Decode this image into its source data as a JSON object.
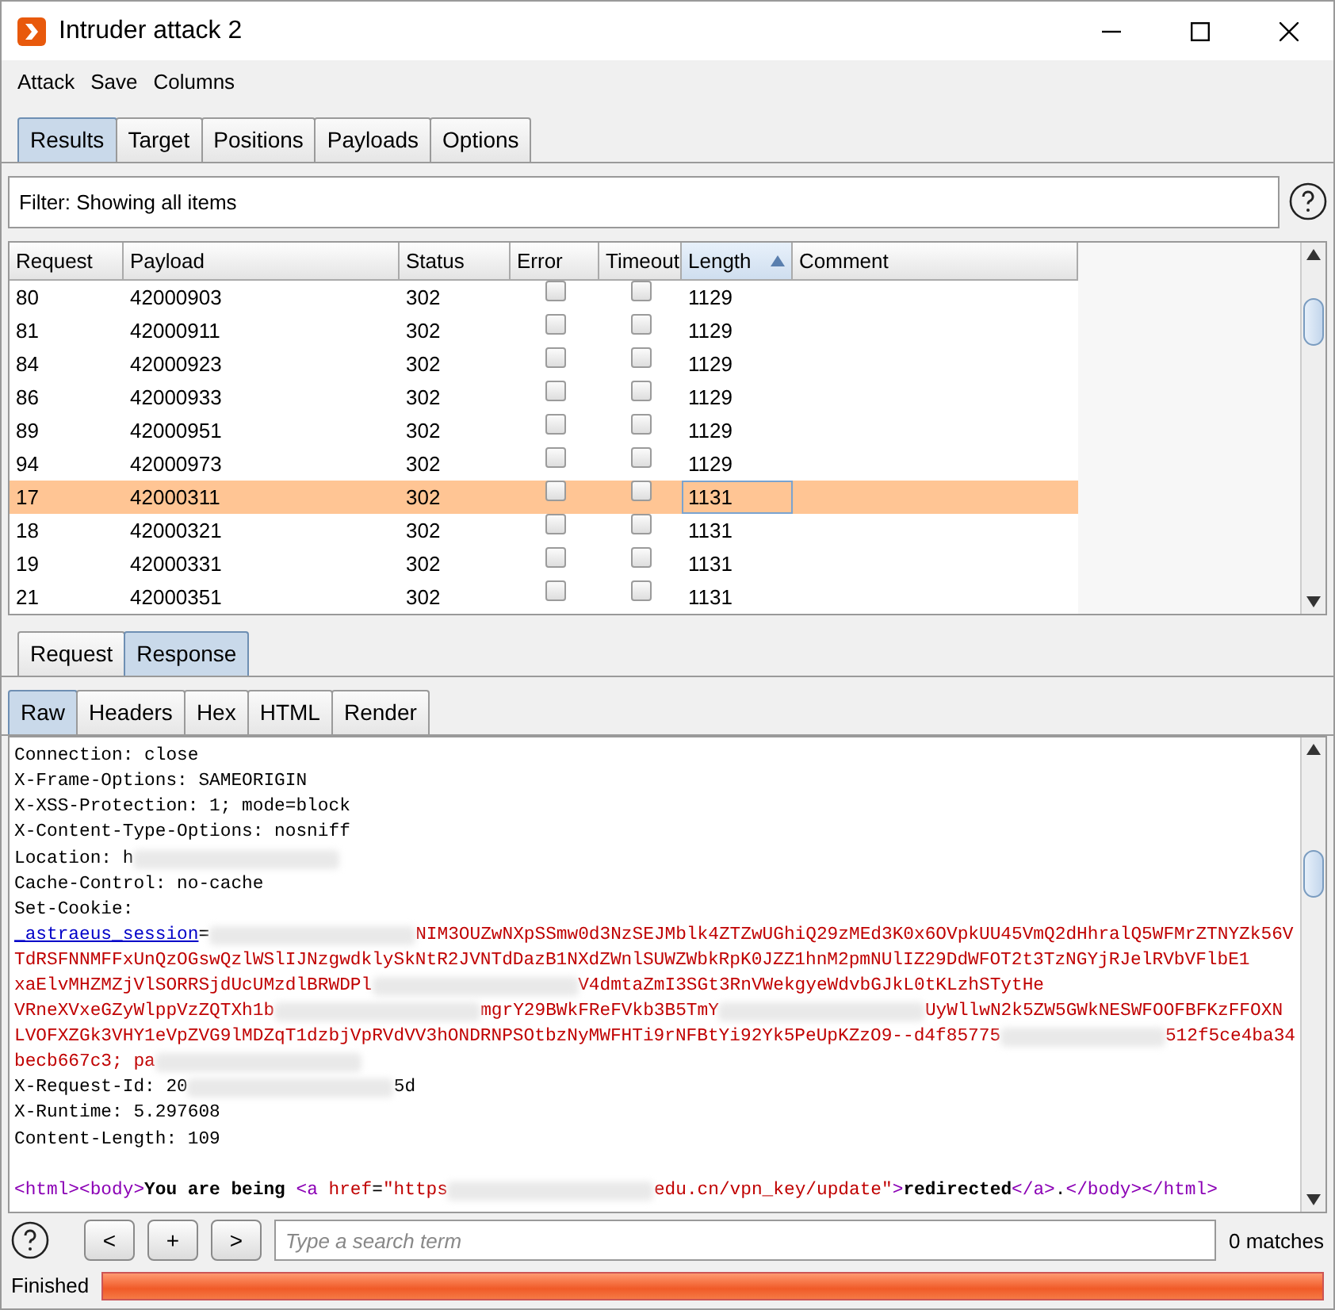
{
  "window": {
    "title": "Intruder attack 2"
  },
  "menu": [
    "Attack",
    "Save",
    "Columns"
  ],
  "tabs": [
    {
      "label": "Results",
      "selected": true
    },
    {
      "label": "Target",
      "selected": false
    },
    {
      "label": "Positions",
      "selected": false
    },
    {
      "label": "Payloads",
      "selected": false
    },
    {
      "label": "Options",
      "selected": false
    }
  ],
  "filter": {
    "text": "Filter: Showing all items"
  },
  "table": {
    "columns": [
      {
        "label": "Request",
        "sorted": false
      },
      {
        "label": "Payload",
        "sorted": false
      },
      {
        "label": "Status",
        "sorted": false
      },
      {
        "label": "Error",
        "sorted": false
      },
      {
        "label": "Timeout",
        "sorted": false
      },
      {
        "label": "Length",
        "sorted": true
      },
      {
        "label": "Comment",
        "sorted": false
      }
    ],
    "rows": [
      {
        "request": "80",
        "payload": "42000903",
        "status": "302",
        "error": false,
        "timeout": false,
        "length": "1129",
        "selected": false
      },
      {
        "request": "81",
        "payload": "42000911",
        "status": "302",
        "error": false,
        "timeout": false,
        "length": "1129",
        "selected": false
      },
      {
        "request": "84",
        "payload": "42000923",
        "status": "302",
        "error": false,
        "timeout": false,
        "length": "1129",
        "selected": false
      },
      {
        "request": "86",
        "payload": "42000933",
        "status": "302",
        "error": false,
        "timeout": false,
        "length": "1129",
        "selected": false
      },
      {
        "request": "89",
        "payload": "42000951",
        "status": "302",
        "error": false,
        "timeout": false,
        "length": "1129",
        "selected": false
      },
      {
        "request": "94",
        "payload": "42000973",
        "status": "302",
        "error": false,
        "timeout": false,
        "length": "1129",
        "selected": false
      },
      {
        "request": "17",
        "payload": "42000311",
        "status": "302",
        "error": false,
        "timeout": false,
        "length": "1131",
        "selected": true
      },
      {
        "request": "18",
        "payload": "42000321",
        "status": "302",
        "error": false,
        "timeout": false,
        "length": "1131",
        "selected": false
      },
      {
        "request": "19",
        "payload": "42000331",
        "status": "302",
        "error": false,
        "timeout": false,
        "length": "1131",
        "selected": false
      },
      {
        "request": "21",
        "payload": "42000351",
        "status": "302",
        "error": false,
        "timeout": false,
        "length": "1131",
        "selected": false
      }
    ]
  },
  "message_tabs": [
    {
      "label": "Request",
      "selected": false
    },
    {
      "label": "Response",
      "selected": true
    }
  ],
  "view_tabs": [
    {
      "label": "Raw",
      "selected": true
    },
    {
      "label": "Headers",
      "selected": false
    },
    {
      "label": "Hex",
      "selected": false
    },
    {
      "label": "HTML",
      "selected": false
    },
    {
      "label": "Render",
      "selected": false
    }
  ],
  "response_lines": [
    [
      {
        "kind": "plain",
        "text": "Connection: close"
      }
    ],
    [
      {
        "kind": "plain",
        "text": "X-Frame-Options: SAMEORIGIN"
      }
    ],
    [
      {
        "kind": "plain",
        "text": "X-XSS-Protection: 1; mode=block"
      }
    ],
    [
      {
        "kind": "plain",
        "text": "X-Content-Type-Options: nosniff"
      }
    ],
    [
      {
        "kind": "plain",
        "text": "Location: h"
      },
      {
        "kind": "redacted"
      }
    ],
    [
      {
        "kind": "plain",
        "text": "Cache-Control: no-cache"
      }
    ],
    [
      {
        "kind": "plain",
        "text": "Set-Cookie:"
      }
    ],
    [
      {
        "kind": "cookie-name",
        "text": "_astraeus_session"
      },
      {
        "kind": "plain",
        "text": "="
      },
      {
        "kind": "redacted"
      },
      {
        "kind": "value",
        "text": "NIM3OUZwNXpSSmw0d3NzSEJMblk4ZTZwUGhiQ29zMEd3K0x6OVpkUU45VmQ2dHhralQ5WFMrZTNYZk56V"
      }
    ],
    [
      {
        "kind": "value",
        "text": "TdRSFNNMFFxUnQzOGswQzlWSlIJNzgwdklySkNtR2JVNTdDazB1NXdZWnlSUWZWbkRpK0JZZ1hnM2pmNUlIZ29DdWFOT2t3TzNGYjRJelRVbVFlbE1"
      }
    ],
    [
      {
        "kind": "value",
        "text": "xaElvMHZMZjVlSORRSjdUcUMzdlBRWDPl"
      },
      {
        "kind": "redacted"
      },
      {
        "kind": "value",
        "text": "V4dmtaZmI3SGt3RnVWekgyeWdvbGJkL0tKLzhSTytHe"
      }
    ],
    [
      {
        "kind": "value",
        "text": "VRneXVxeGZyWlppVzZQTXh1b"
      },
      {
        "kind": "redacted"
      },
      {
        "kind": "value",
        "text": "mgrY29BWkFReFVkb3B5TmY"
      },
      {
        "kind": "redacted"
      },
      {
        "kind": "value",
        "text": "UyWllwN2k5ZW5GWkNESWFOOFBFKzFFOXN"
      }
    ],
    [
      {
        "kind": "value",
        "text": "LVOFXZGk3VHY1eVpZVG9lMDZqT1dzbjVpRVdVV3hONDRNPSOtbzNyMWFHTi9rNFBtYi92Yk5PeUpKZzO9--d4f85775"
      },
      {
        "kind": "redacted"
      },
      {
        "kind": "value",
        "text": "512f5ce4ba34"
      }
    ],
    [
      {
        "kind": "value",
        "text": "becb667c3; pa"
      },
      {
        "kind": "redacted"
      }
    ],
    [
      {
        "kind": "plain",
        "text": "X-Request-Id: 20"
      },
      {
        "kind": "redacted"
      },
      {
        "kind": "plain",
        "text": "5d"
      }
    ],
    [
      {
        "kind": "plain",
        "text": "X-Runtime: 5.297608"
      }
    ],
    [
      {
        "kind": "plain",
        "text": "Content-Length: 109"
      }
    ],
    [
      {
        "kind": "blank"
      }
    ],
    [
      {
        "kind": "tag",
        "text": "<html><body>"
      },
      {
        "kind": "body",
        "text": "You are being "
      },
      {
        "kind": "tag",
        "text": "<a "
      },
      {
        "kind": "attr",
        "text": "href"
      },
      {
        "kind": "plain",
        "text": "="
      },
      {
        "kind": "value",
        "text": "\"https"
      },
      {
        "kind": "redacted"
      },
      {
        "kind": "value",
        "text": "edu.cn/vpn_key/update\""
      },
      {
        "kind": "tag",
        "text": ">"
      },
      {
        "kind": "body",
        "text": "redirected"
      },
      {
        "kind": "tag",
        "text": "</a>"
      },
      {
        "kind": "plain",
        "text": "."
      },
      {
        "kind": "tag",
        "text": "</body></html>"
      }
    ]
  ],
  "search": {
    "buttons": [
      "<",
      "+",
      ">"
    ],
    "placeholder": "Type a search term",
    "matches": "0 matches"
  },
  "status": {
    "text": "Finished",
    "level": 1.0
  }
}
